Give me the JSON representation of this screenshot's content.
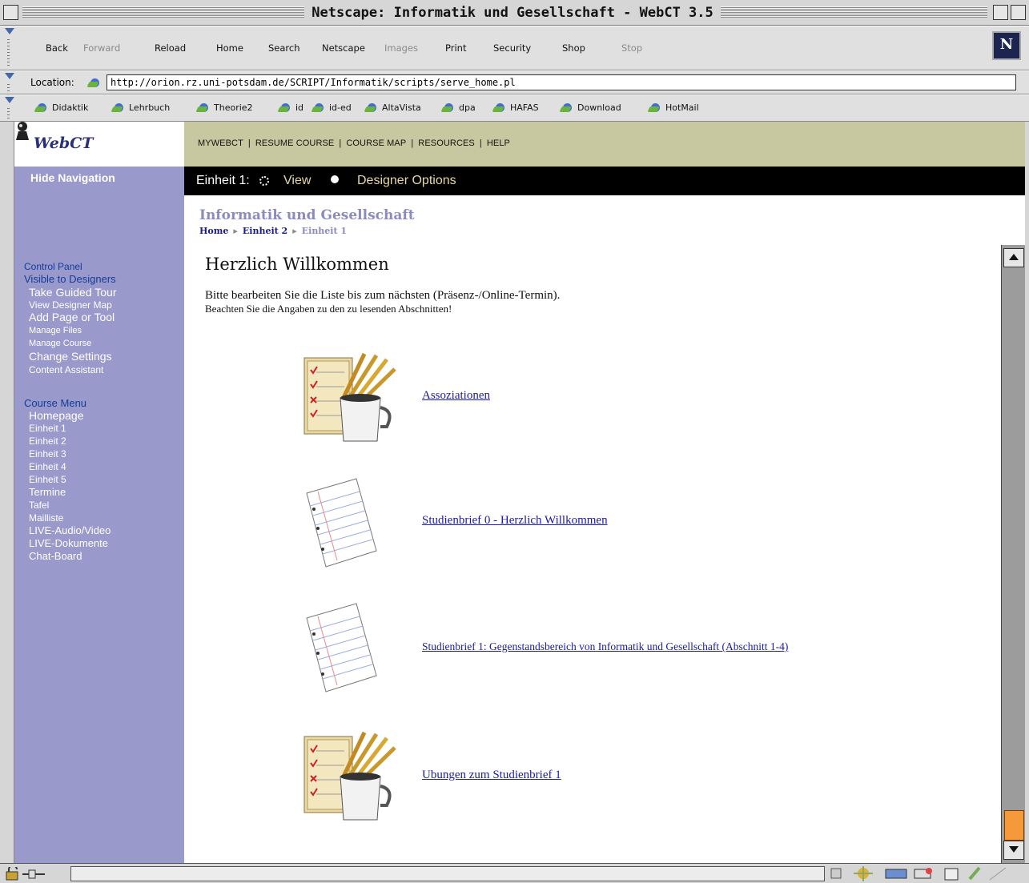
{
  "window": {
    "title": "Netscape: Informatik und Gesellschaft - WebCT 3.5"
  },
  "toolbar": {
    "buttons": [
      "Back",
      "Forward",
      "Reload",
      "Home",
      "Search",
      "Netscape",
      "Images",
      "Print",
      "Security",
      "Shop",
      "Stop"
    ],
    "logo_letter": "N"
  },
  "location": {
    "label": "Location:",
    "url": "http://orion.rz.uni-potsdam.de/SCRIPT/Informatik/scripts/serve_home.pl"
  },
  "bookmarks": [
    "Didaktik",
    "Lehrbuch",
    "Theorie2",
    "id",
    "id-ed",
    "AltaVista",
    "dpa",
    "HAFAS",
    "Download",
    "HotMail"
  ],
  "webct": {
    "logo": "WebCT",
    "menu": [
      "MYWEBCT",
      "RESUME COURSE",
      "COURSE MAP",
      "RESOURCES",
      "HELP"
    ],
    "hide_nav": "Hide Navigation",
    "unit_label": "Einheit 1:",
    "view_label": "View",
    "designer_options": "Designer Options",
    "course_title": "Informatik und Gesellschaft",
    "breadcrumb": [
      "Home",
      "Einheit 2",
      "Einheit 1"
    ]
  },
  "sidebar": {
    "control_panel": "Control Panel",
    "visible_to_designers": "Visible to Designers",
    "designer_items": [
      "Take Guided Tour",
      "View Designer Map",
      "Add Page or Tool",
      "Manage Files",
      "Manage Course",
      "Change Settings",
      "Content Assistant"
    ],
    "course_menu": "Course Menu",
    "course_items": [
      "Homepage",
      "Einheit 1",
      "Einheit 2",
      "Einheit 3",
      "Einheit 4",
      "Einheit 5",
      "Termine",
      "Tafel",
      "Mailliste",
      "LIVE-Audio/Video",
      "LIVE-Dokumente",
      "Chat-Board"
    ]
  },
  "content": {
    "heading": "Herzlich Willkommen",
    "intro_line1": "Bitte bearbeiten Sie die Liste bis zum nächsten (Präsenz-/Online-Termin).",
    "intro_line2": "Beachten Sie die Angaben zu den zu lesenden Abschnitten!",
    "items": [
      {
        "label": "Assoziationen",
        "icon": "checklist-pencils-icon"
      },
      {
        "label": "Studienbrief 0 - Herzlich Willkommen",
        "icon": "notepaper-icon"
      },
      {
        "label": "Studienbrief 1: Gegenstandsbereich von Informatik und Gesellschaft (Abschnitt 1-4)",
        "icon": "notepaper-icon"
      },
      {
        "label": "Ubungen zum Studienbrief 1",
        "icon": "checklist-pencils-icon"
      }
    ]
  },
  "colors": {
    "sidebar": "#9999cc",
    "menu_bar": "#c8c8a0",
    "unit_bar": "#000000",
    "link": "#1a1aaa",
    "scroll_thumb": "#f59a3a"
  }
}
